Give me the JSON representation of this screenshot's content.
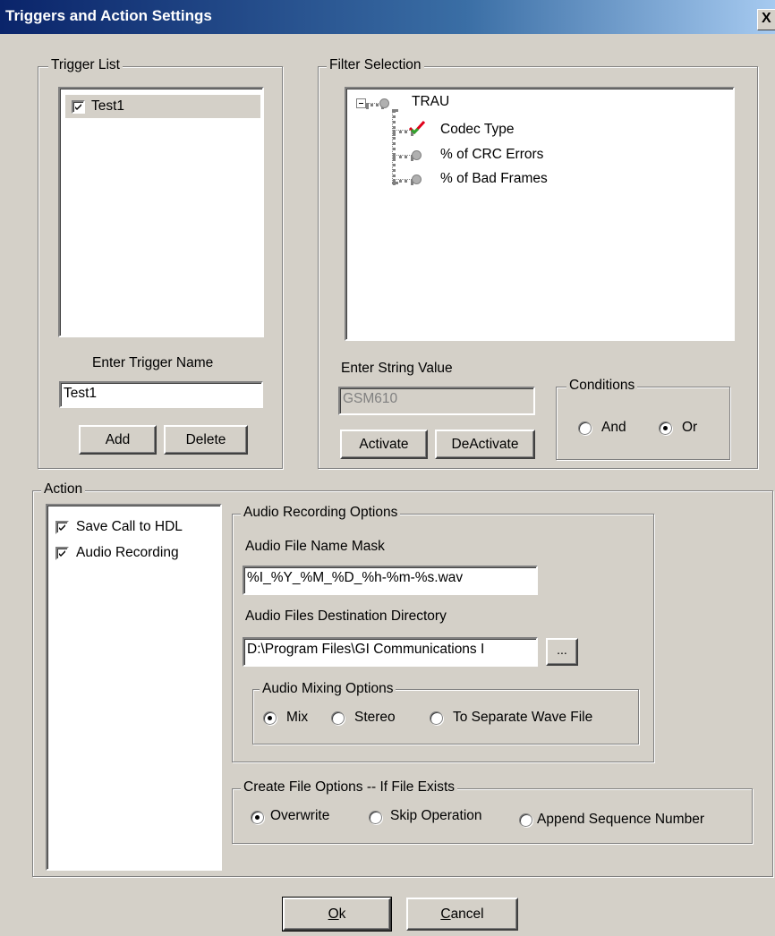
{
  "window": {
    "title": "Triggers and Action Settings",
    "close_label": "X"
  },
  "trigger_list": {
    "legend": "Trigger List",
    "items": [
      {
        "label": "Test1",
        "checked": true
      }
    ],
    "name_label": "Enter Trigger Name",
    "name_value": "Test1",
    "add_label": "Add",
    "delete_label": "Delete"
  },
  "filter": {
    "legend": "Filter Selection",
    "tree": {
      "root": "TRAU",
      "children": [
        "Codec Type",
        "% of CRC Errors",
        "% of Bad Frames"
      ]
    },
    "string_label": "Enter String Value",
    "string_value": "GSM610",
    "activate_label": "Activate",
    "deactivate_label": "DeActivate",
    "conditions": {
      "legend": "Conditions",
      "and_label": "And",
      "or_label": "Or",
      "selected": "Or"
    }
  },
  "action": {
    "legend": "Action",
    "items": [
      {
        "label": "Save Call to HDL",
        "checked": true
      },
      {
        "label": "Audio Recording",
        "checked": true
      }
    ],
    "audio": {
      "legend": "Audio Recording Options",
      "mask_label": "Audio File Name Mask",
      "mask_value": "%I_%Y_%M_%D_%h-%m-%s.wav",
      "dir_label": "Audio Files Destination Directory",
      "dir_value": "D:\\Program Files\\GI Communications I",
      "browse_label": "...",
      "mixing": {
        "legend": "Audio Mixing Options",
        "options": [
          "Mix",
          "Stereo",
          "To Separate Wave File"
        ],
        "selected": "Mix"
      }
    },
    "create": {
      "legend": "Create File Options -- If File Exists",
      "options": [
        "Overwrite",
        "Skip Operation",
        "Append Sequence Number"
      ],
      "selected": "Overwrite"
    }
  },
  "footer": {
    "ok_mnemonic": "O",
    "ok_rest": "k",
    "cancel_mnemonic": "C",
    "cancel_rest": "ancel"
  },
  "colors": {
    "titlebar_start": "#0a246a",
    "face": "#d4d0c8",
    "check_red": "#e0001a",
    "check_green": "#2fa52f"
  }
}
